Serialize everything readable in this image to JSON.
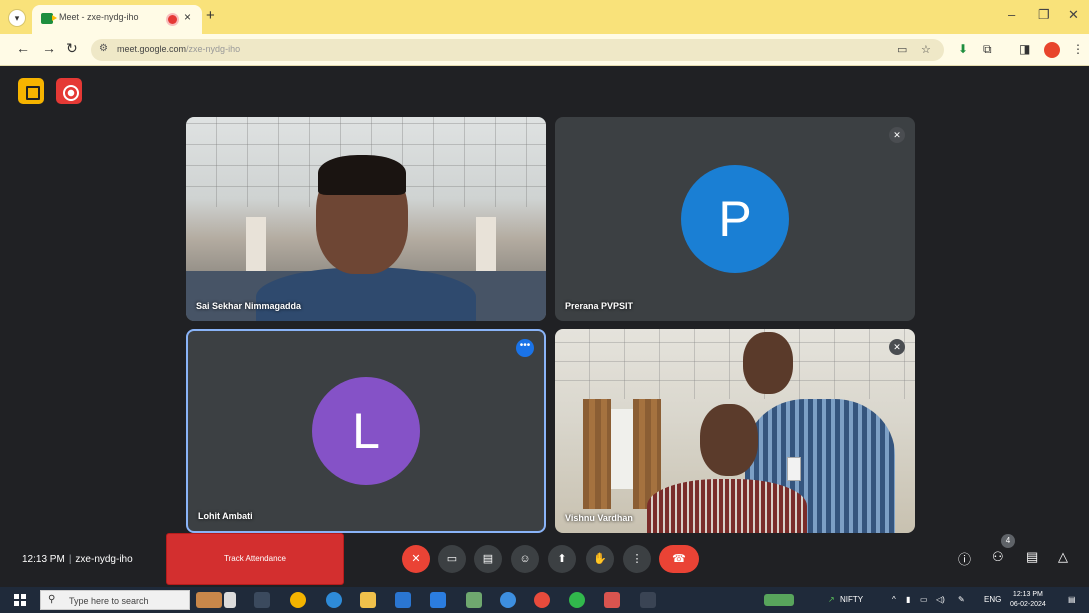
{
  "browser": {
    "tab_title": "Meet - zxe-nydg-iho",
    "tab_close": "×",
    "new_tab": "+",
    "window_controls": {
      "minimize": "–",
      "restore": "❐",
      "close": "✕"
    },
    "nav": {
      "back": "←",
      "forward": "→",
      "reload": "↻"
    },
    "url_domain": "meet.google.com",
    "url_path": "/zxe-nydg-iho",
    "icons": [
      "site-info-icon",
      "camera-blocked-icon",
      "bookmark-star-icon",
      "download-icon",
      "extensions-icon",
      "side-panel-icon",
      "profile-avatar"
    ]
  },
  "participants": [
    {
      "name": "Sai Sekhar Nimmagadda",
      "type": "video"
    },
    {
      "name": "Prerana PVPSIT",
      "type": "avatar",
      "initial": "P",
      "avatar_color": "#1a7fd4",
      "muted": true
    },
    {
      "name": "Lohit Ambati",
      "type": "avatar",
      "initial": "L",
      "avatar_color": "#8552c7",
      "speaking_highlight": true,
      "more_options": "•••"
    },
    {
      "name": "Vishnu Vardhan",
      "type": "video",
      "muted": true
    }
  ],
  "meeting": {
    "time": "12:13 PM",
    "separator": "|",
    "code": "zxe-nydg-iho",
    "track_attendance_label": "Track Attendance",
    "people_count": "4",
    "controls": [
      "mic-off-icon",
      "camera-icon",
      "captions-icon",
      "emoji-icon",
      "present-icon",
      "raise-hand-icon",
      "more-options-icon",
      "hang-up-icon"
    ],
    "right_controls": [
      "info-icon",
      "people-icon",
      "chat-icon",
      "activities-icon"
    ]
  },
  "taskbar": {
    "search_placeholder": "Type here to search",
    "nifty_label": "NIFTY",
    "language": "ENG",
    "clock_time": "12:13 PM",
    "clock_date": "06-02-2024"
  },
  "colors": {
    "tabstrip": "#f9e27a",
    "meet_bg": "#202124",
    "tile_bg": "#3c4043",
    "active_border": "#8ab4f8",
    "hangup_red": "#ea4335",
    "track_btn": "#d32f2f"
  }
}
